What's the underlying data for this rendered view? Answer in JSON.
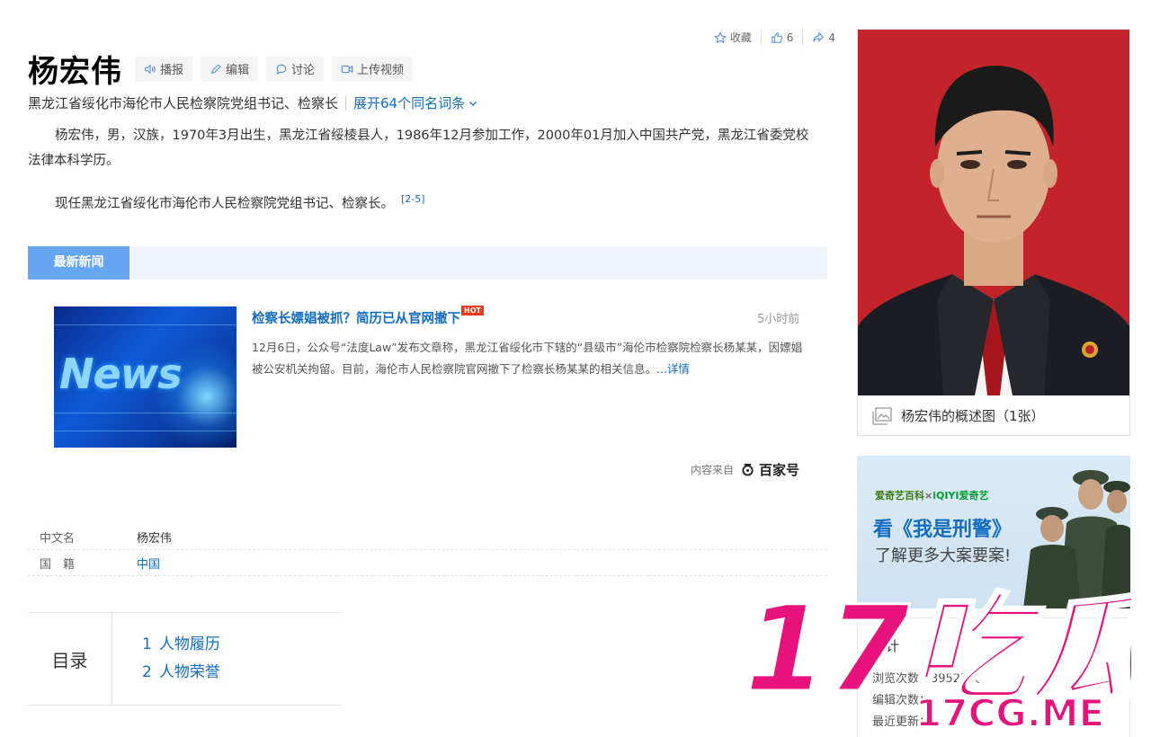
{
  "actions": {
    "collect_label": "收藏",
    "like_count": "6",
    "share_count": "4"
  },
  "header": {
    "title": "杨宏伟",
    "buttons": {
      "play": "播报",
      "edit": "编辑",
      "discuss": "讨论",
      "upload": "上传视频"
    },
    "subtitle": "黑龙江省绥化市海伦市人民检察院党组书记、检察长",
    "expand_link": "展开64个同名词条"
  },
  "summary": {
    "para1": "杨宏伟，男，汉族，1970年3月出生，黑龙江省绥棱县人，1986年12月参加工作，2000年01月加入中国共产党，黑龙江省委党校法律本科学历。",
    "para2": "现任黑龙江省绥化市海伦市人民检察院党组书记、检察长。",
    "ref": "[2-5]"
  },
  "news": {
    "tab_label": "最新新闻",
    "thumb_text": "News",
    "item_title": "检察长嫖娼被抓？简历已从官网撤下",
    "hot_badge": "HOT",
    "time": "5小时前",
    "description": "12月6日，公众号“法度Law”发布文章称，黑龙江省绥化市下辖的“县级市”海伦市检察院检察长杨某某，因嫖娼被公安机关拘留。目前，海伦市人民检察院官网撤下了检察长杨某某的相关信息。",
    "more": "...详情",
    "source_prefix": "内容来自",
    "source_brand": "百家号"
  },
  "basic_info": [
    {
      "key": "中文名",
      "value": "杨宏伟",
      "link": false
    },
    {
      "key": "国　籍",
      "value": "中国",
      "link": true
    }
  ],
  "toc": {
    "label": "目录",
    "items": [
      {
        "num": "1",
        "label": "人物履历"
      },
      {
        "num": "2",
        "label": "人物荣誉"
      }
    ]
  },
  "sidebar": {
    "photo_caption": "杨宏伟的概述图（1张）",
    "ad": {
      "logo_left": "爱奇艺百科",
      "logo_x": "×",
      "logo_right": "iQIYI爱奇艺",
      "line1": "看《我是刑警》",
      "line2": "了解更多大案要案!"
    },
    "stats": {
      "title": "统计",
      "views": "浏览次数：39525次",
      "edits": "编辑次数：",
      "updated": "最近更新："
    }
  },
  "watermark": {
    "big": "17吃瓜",
    "small": "17CG.ME"
  },
  "colors": {
    "link": "#136ec2",
    "tab": "#66a5f0",
    "watermark": "#e8127c"
  }
}
